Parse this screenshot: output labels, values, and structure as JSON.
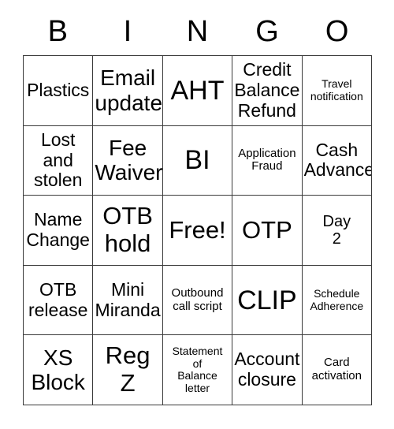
{
  "card": {
    "header_letters": [
      "B",
      "I",
      "N",
      "G",
      "O"
    ],
    "rows": [
      [
        {
          "label": "Plastics",
          "size": "md"
        },
        {
          "label": "Email\nupdate",
          "size": "lg"
        },
        {
          "label": "AHT",
          "size": "xxl"
        },
        {
          "label": "Credit\nBalance\nRefund",
          "size": "md"
        },
        {
          "label": "Travel\nnotification",
          "size": "xxs"
        }
      ],
      [
        {
          "label": "Lost\nand\nstolen",
          "size": "md"
        },
        {
          "label": "Fee\nWaiver",
          "size": "lg"
        },
        {
          "label": "BI",
          "size": "xxl"
        },
        {
          "label": "Application\nFraud",
          "size": "xs"
        },
        {
          "label": "Cash\nAdvance",
          "size": "md"
        }
      ],
      [
        {
          "label": "Name\nChange",
          "size": "md"
        },
        {
          "label": "OTB\nhold",
          "size": "xl"
        },
        {
          "label": "Free!",
          "size": "xl"
        },
        {
          "label": "OTP",
          "size": "xl"
        },
        {
          "label": "Day\n2",
          "size": "sm"
        }
      ],
      [
        {
          "label": "OTB\nrelease",
          "size": "md"
        },
        {
          "label": "Mini\nMiranda",
          "size": "md"
        },
        {
          "label": "Outbound\ncall script",
          "size": "xs"
        },
        {
          "label": "CLIP",
          "size": "xxl"
        },
        {
          "label": "Schedule\nAdherence",
          "size": "xxs"
        }
      ],
      [
        {
          "label": "XS\nBlock",
          "size": "lg"
        },
        {
          "label": "Reg\nZ",
          "size": "xl"
        },
        {
          "label": "Statement\nof\nBalance\nletter",
          "size": "xxs"
        },
        {
          "label": "Account\nclosure",
          "size": "md"
        },
        {
          "label": "Card\nactivation",
          "size": "xs"
        }
      ]
    ],
    "colors": {
      "background": "#ffffff",
      "border": "#3a3a3a",
      "text": "#000000"
    }
  }
}
